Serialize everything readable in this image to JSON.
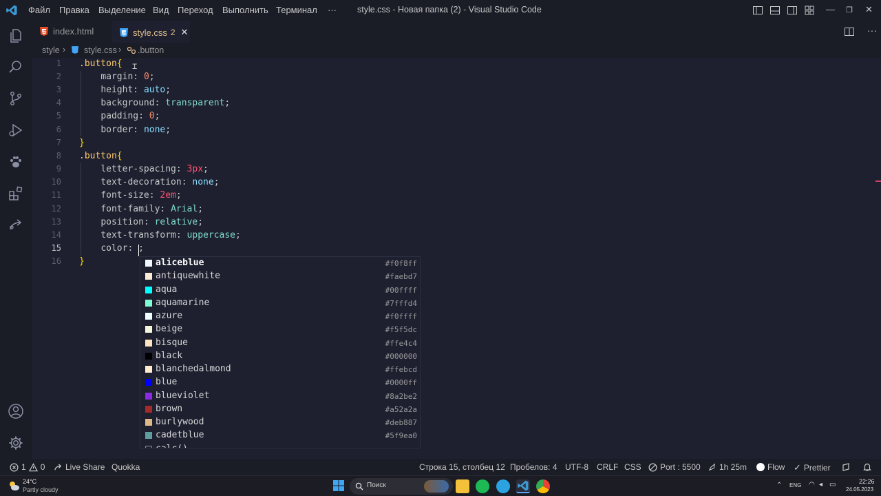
{
  "titlebar": {
    "menu": [
      "Файл",
      "Правка",
      "Выделение",
      "Вид",
      "Переход",
      "Выполнить",
      "Терминал",
      "···"
    ],
    "title": "style.css - Новая папка (2) - Visual Studio Code"
  },
  "tabs": [
    {
      "label": "index.html",
      "icon": "html5-icon",
      "icon_color": "#e44d26"
    },
    {
      "label": "style.css",
      "badge": "2",
      "icon": "css3-icon",
      "icon_color": "#42a5f5",
      "close": "✕"
    }
  ],
  "breadcrumb": {
    "folder": "style",
    "file": "style.css",
    "symbol": ".button"
  },
  "editor": {
    "current_line": 15,
    "line_numbers": [
      "1",
      "2",
      "3",
      "4",
      "5",
      "6",
      "7",
      "8",
      "9",
      "10",
      "11",
      "12",
      "13",
      "14",
      "15",
      "16"
    ]
  },
  "code": {
    "l1": {
      "sel": ".button",
      "brace": "{"
    },
    "l2": {
      "prop": "margin",
      "val": "0"
    },
    "l3": {
      "prop": "height",
      "val": "auto"
    },
    "l4": {
      "prop": "background",
      "val": "transparent"
    },
    "l5": {
      "prop": "padding",
      "val": "0"
    },
    "l6": {
      "prop": "border",
      "val": "none"
    },
    "l7": {
      "brace": "}"
    },
    "l8": {
      "sel": ".button",
      "brace": "{"
    },
    "l9": {
      "prop": "letter-spacing",
      "val": "3px"
    },
    "l10": {
      "prop": "text-decoration",
      "val": "none"
    },
    "l11": {
      "prop": "font-size",
      "val": "2em"
    },
    "l12": {
      "prop": "font-family",
      "val": "Arial"
    },
    "l13": {
      "prop": "position",
      "val": "relative"
    },
    "l14": {
      "prop": "text-transform",
      "val": "uppercase"
    },
    "l15": {
      "prop": "color",
      "val": ";"
    },
    "l16": {
      "brace": "}"
    }
  },
  "suggestions": [
    {
      "label": "aliceblue",
      "hex": "#f0f8ff"
    },
    {
      "label": "antiquewhite",
      "hex": "#faebd7"
    },
    {
      "label": "aqua",
      "hex": "#00ffff"
    },
    {
      "label": "aquamarine",
      "hex": "#7fffd4"
    },
    {
      "label": "azure",
      "hex": "#f0ffff"
    },
    {
      "label": "beige",
      "hex": "#f5f5dc"
    },
    {
      "label": "bisque",
      "hex": "#ffe4c4"
    },
    {
      "label": "black",
      "hex": "#000000"
    },
    {
      "label": "blanchedalmond",
      "hex": "#ffebcd"
    },
    {
      "label": "blue",
      "hex": "#0000ff"
    },
    {
      "label": "blueviolet",
      "hex": "#8a2be2"
    },
    {
      "label": "brown",
      "hex": "#a52a2a"
    },
    {
      "label": "burlywood",
      "hex": "#deb887"
    },
    {
      "label": "cadetblue",
      "hex": "#5f9ea0"
    },
    {
      "label": "calc()",
      "hex": ""
    }
  ],
  "statusbar": {
    "errors": "1",
    "warnings": "0",
    "liveshare": "Live Share",
    "quokka": "Quokka",
    "position": "Строка 15, столбец 12",
    "spaces": "Пробелов: 4",
    "encoding": "UTF-8",
    "eol": "CRLF",
    "language": "CSS",
    "port": "Port : 5500",
    "time": "1h 25m",
    "flow": "Flow",
    "prettier": "Prettier"
  },
  "taskbar": {
    "temp": "24°C",
    "weather": "Partly cloudy",
    "search_placeholder": "Поиск",
    "lang": "ENG",
    "clock": "22:26",
    "date": "24.05.2023"
  },
  "colors": {
    "accent": "#007acc",
    "tab_active_bg": "#1e2030",
    "editor_bg": "#1e2030"
  }
}
